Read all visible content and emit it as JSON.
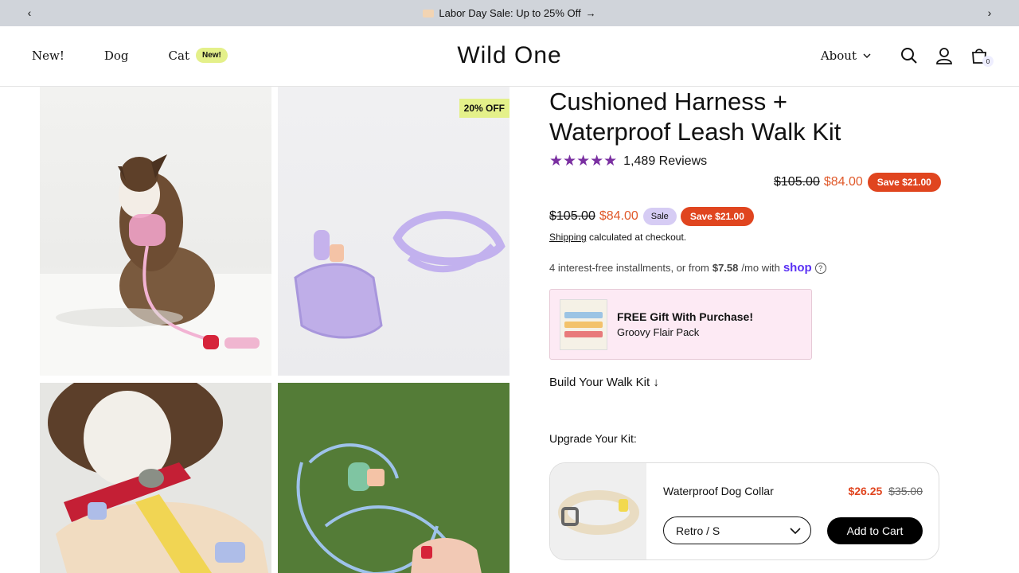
{
  "announcement": {
    "text": "Labor Day Sale: Up to 25% Off",
    "arrow": "→"
  },
  "header": {
    "nav": {
      "new": "New!",
      "dog": "Dog",
      "cat": "Cat",
      "cat_badge": "New!"
    },
    "logo": "Wild One",
    "about": "About",
    "cart_count": "0"
  },
  "gallery": {
    "badge": "20% OFF"
  },
  "product": {
    "title_line1": "Cushioned Harness +",
    "title_line2": "Waterproof Leash Walk Kit",
    "stars": "★★★★★",
    "rating": 4.6,
    "reviews": "1,489 Reviews",
    "price_compare": "$105.00",
    "price_sale": "$84.00",
    "save_label": "Save $21.00",
    "sale_label": "Sale",
    "shipping_link": "Shipping",
    "shipping_rest": " calculated at checkout.",
    "installments": "4 interest-free installments, or from",
    "installment_amount": "$7.58",
    "installment_suffix": "/mo with",
    "shop_brand": "shop",
    "help_glyph": "?",
    "gift_title": "FREE Gift With Purchase!",
    "gift_sub": "Groovy Flair Pack",
    "build_kit": "Build Your Walk Kit ↓",
    "upgrade_label": "Upgrade Your Kit:"
  },
  "upsell": {
    "name": "Waterproof Dog Collar",
    "price_sale": "$26.25",
    "price_compare": "$35.00",
    "variant": "Retro / S",
    "add_to_cart": "Add to Cart"
  },
  "colors": {
    "accent_purple": "#7a2fa1",
    "sale_orange": "#e0592a",
    "badge_lime": "#e4f08a",
    "shop_purple": "#5a31f4"
  }
}
